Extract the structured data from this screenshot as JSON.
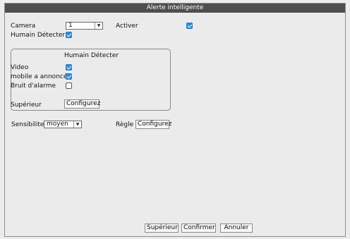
{
  "window": {
    "title": "Alerte intelligente"
  },
  "form": {
    "camera_label": "Camera",
    "camera_value": "1",
    "activer_label": "Activer",
    "humain_label": "Humain Détecter"
  },
  "group": {
    "title": "Humain Détecter",
    "video_label": "Video",
    "mobile_label": "mobile a annoncé",
    "bruit_label": "Bruit d'alarme",
    "superieur_label": "Supérieur",
    "configurez_label": "Configurez"
  },
  "sensitivity": {
    "label": "Sensibilite",
    "value": "moyen",
    "regle_label": "Règle",
    "configurez_label": "Configurez"
  },
  "footer": {
    "superieur": "Supérieur",
    "confirmer": "Confirmer",
    "annuler": "Annuler"
  },
  "checkboxes": {
    "activer": true,
    "humain_detecter": true,
    "video": true,
    "mobile": true,
    "bruit": false
  },
  "colors": {
    "accent": "#2e8ee0",
    "titlebar": "#4e4e4e"
  }
}
